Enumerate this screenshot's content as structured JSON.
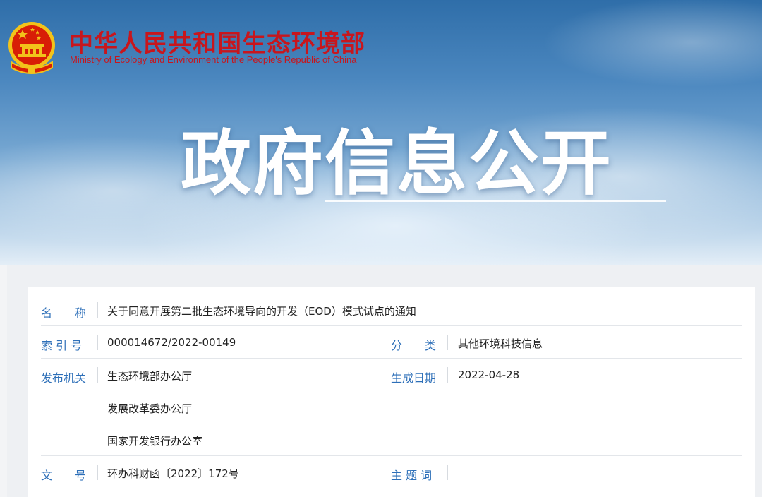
{
  "header": {
    "org_name_cn": "中华人民共和国生态环境部",
    "org_name_en": "Ministry of Ecology and Environment of the People's Republic of China",
    "emblem_icon": "national-emblem-icon",
    "banner_title": "政府信息公开"
  },
  "info": {
    "name_label": "名　　称",
    "name_value": "关于同意开展第二批生态环境导向的开发（EOD）模式试点的通知",
    "index_label": "索 引 号",
    "index_value": "000014672/2022-00149",
    "category_label": "分　　类",
    "category_value": "其他环境科技信息",
    "issuer_label": "发布机关",
    "issuer_values": [
      "生态环境部办公厅",
      "发展改革委办公厅",
      "国家开发银行办公室"
    ],
    "date_label": "生成日期",
    "date_value": "2022-04-28",
    "docno_label": "文　　号",
    "docno_value": "环办科财函〔2022〕172号",
    "keyword_label": "主 题 词",
    "keyword_value": ""
  },
  "colors": {
    "label_blue": "#2d6fb8",
    "brand_red": "#c8161d",
    "emblem_gold": "#f2c31a"
  }
}
